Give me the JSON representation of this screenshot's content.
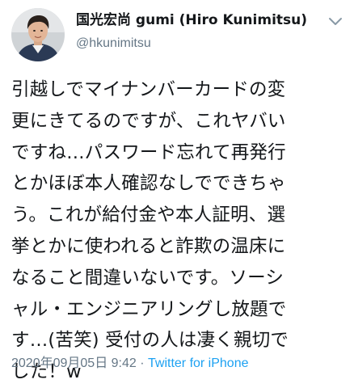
{
  "tweet": {
    "display_name": "国光宏尚 gumi (Hiro Kunimitsu)",
    "handle": "@hkunimitsu",
    "text_lines": [
      "引越しでマイナンバーカードの変",
      "更にきてるのですが、これヤバい",
      "ですね…パスワード忘れて再発行",
      "とかほぼ本人確認なしでできちゃ",
      "う。これが給付金や本人証明、選",
      "挙とかに使われると詐欺の温床に",
      "なること間違いないです。ソーシ",
      "ャル・エンジニアリングし放題で",
      "す…(苦笑) 受付の人は凄く親切で",
      "した！w"
    ],
    "timestamp": "2020年09月05日 9:42",
    "separator": " · ",
    "source": "Twitter for iPhone"
  },
  "icons": {
    "avatar": "profile-photo",
    "menu": "chevron-down-icon"
  },
  "colors": {
    "text": "#14171a",
    "secondary": "#657786",
    "link": "#1da1f2"
  }
}
